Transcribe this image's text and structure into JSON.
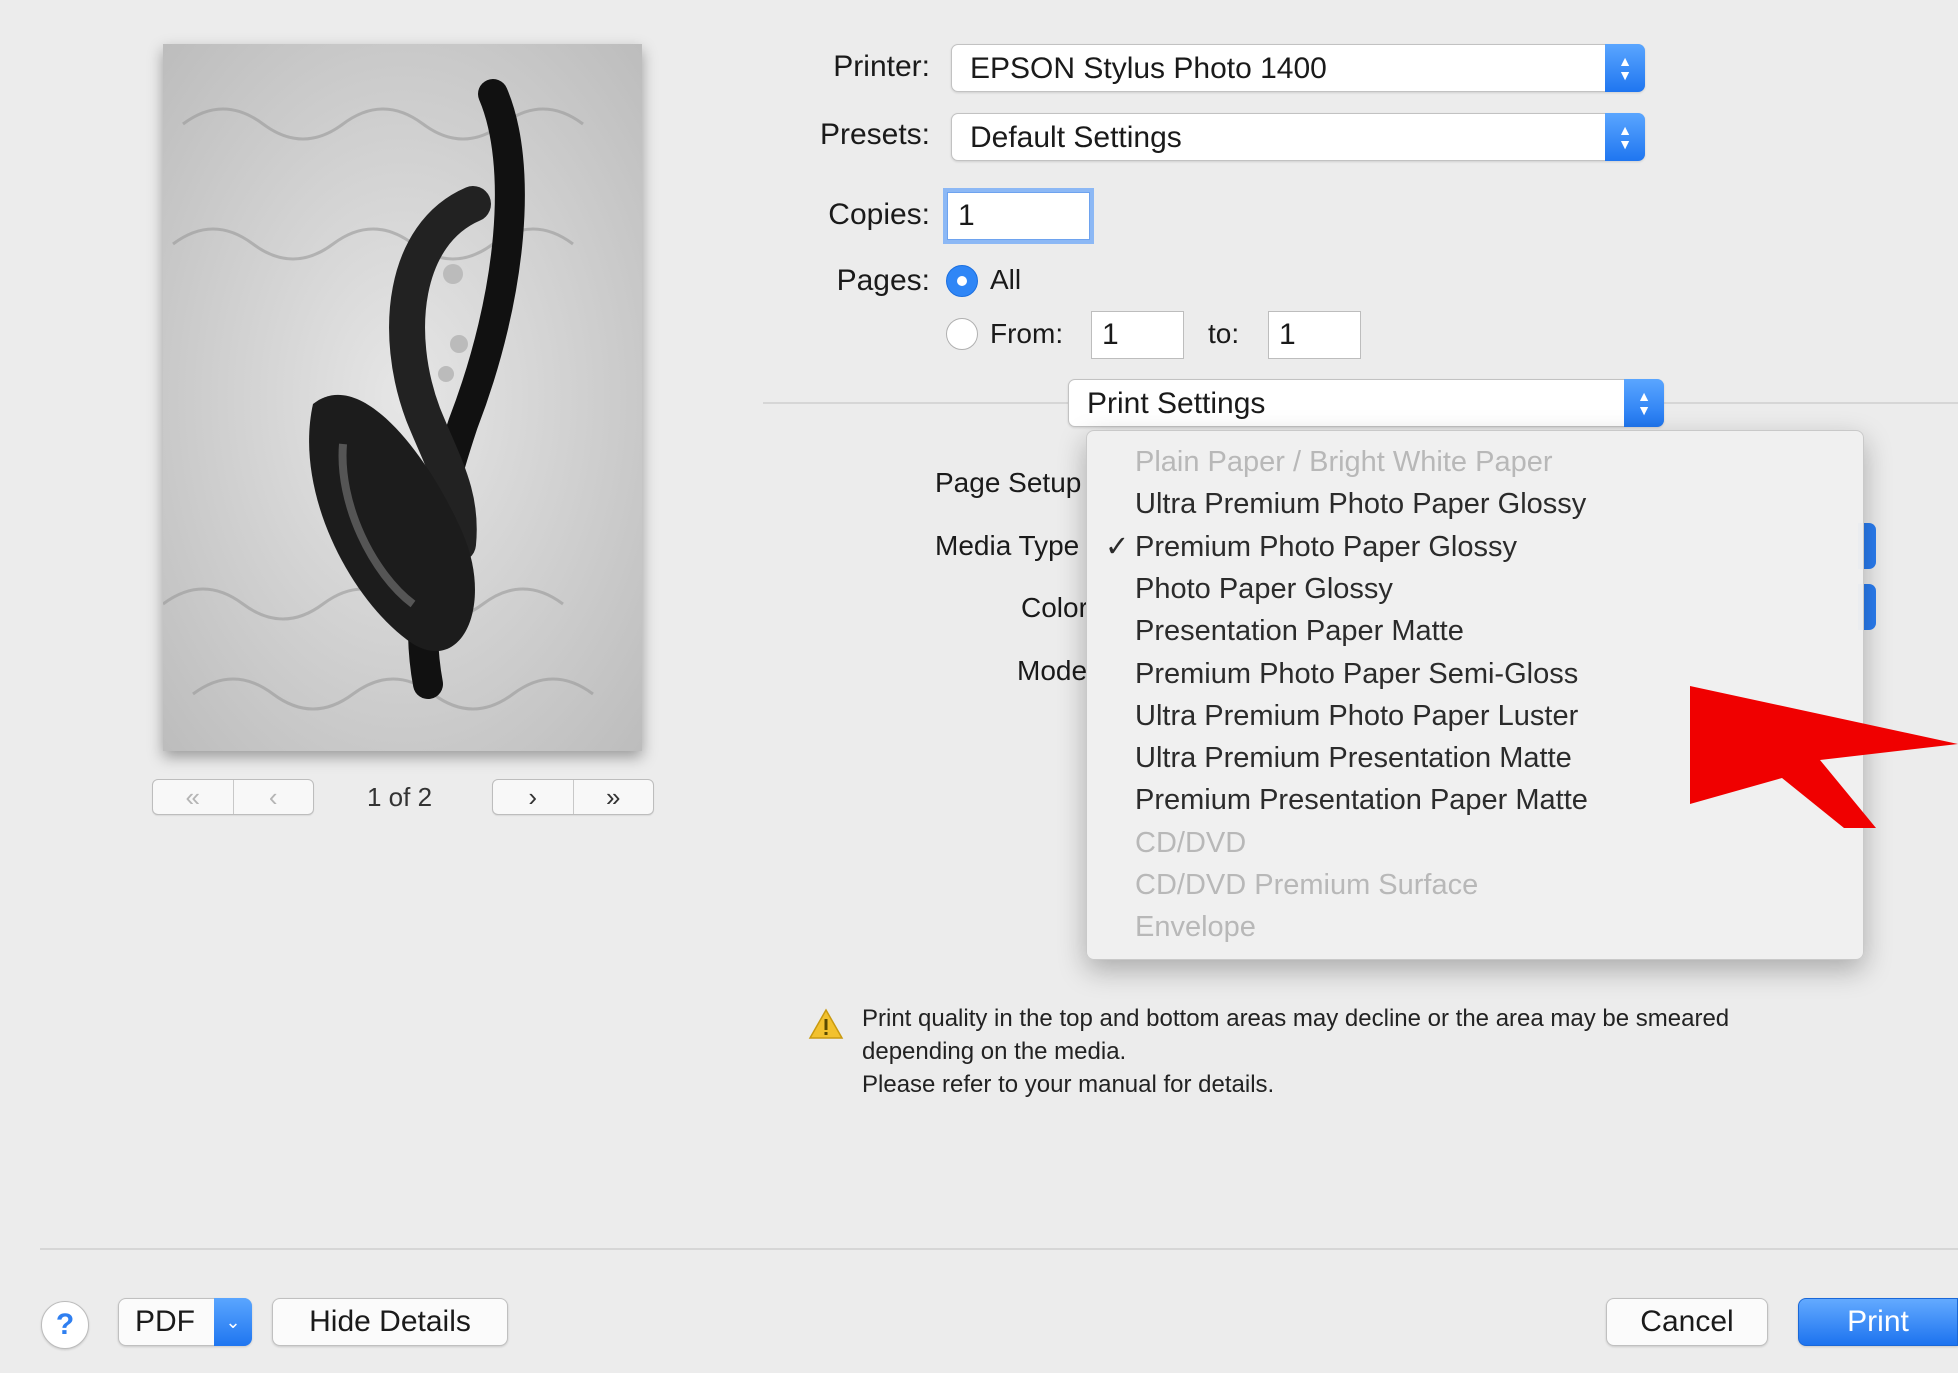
{
  "preview": {
    "page_indicator": "1 of 2",
    "nav_first": "«",
    "nav_prev": "‹",
    "nav_next": "›",
    "nav_last": "»"
  },
  "printer": {
    "label": "Printer:",
    "value": "EPSON Stylus Photo 1400"
  },
  "presets": {
    "label": "Presets:",
    "value": "Default Settings"
  },
  "copies": {
    "label": "Copies:",
    "value": "1"
  },
  "pages": {
    "label": "Pages:",
    "all_label": "All",
    "all_selected": true,
    "from_label": "From:",
    "from_value": "1",
    "to_label": "to:",
    "to_value": "1"
  },
  "section_popup": {
    "value": "Print Settings"
  },
  "settings_labels": {
    "page_setup": "Page Setup",
    "media_type": "Media Type",
    "color": "Color",
    "mode": "Mode"
  },
  "media_menu": {
    "items": [
      {
        "label": "Plain Paper / Bright White Paper",
        "enabled": false,
        "checked": false
      },
      {
        "label": "Ultra Premium Photo Paper Glossy",
        "enabled": true,
        "checked": false
      },
      {
        "label": "Premium Photo Paper Glossy",
        "enabled": true,
        "checked": true
      },
      {
        "label": "Photo Paper Glossy",
        "enabled": true,
        "checked": false
      },
      {
        "label": "Presentation Paper Matte",
        "enabled": true,
        "checked": false
      },
      {
        "label": "Premium Photo Paper Semi-Gloss",
        "enabled": true,
        "checked": false
      },
      {
        "label": "Ultra Premium Photo Paper Luster",
        "enabled": true,
        "checked": false
      },
      {
        "label": "Ultra Premium Presentation Matte",
        "enabled": true,
        "checked": false
      },
      {
        "label": "Premium Presentation Paper Matte",
        "enabled": true,
        "checked": false
      },
      {
        "label": "CD/DVD",
        "enabled": false,
        "checked": false
      },
      {
        "label": "CD/DVD Premium Surface",
        "enabled": false,
        "checked": false
      },
      {
        "label": "Envelope",
        "enabled": false,
        "checked": false
      }
    ],
    "check_glyph": "✓"
  },
  "warning": {
    "line1": "Print quality in the top and bottom areas may decline or the area may be smeared",
    "line2": "depending on the media.",
    "line3": "Please refer to your manual for details."
  },
  "footer": {
    "help": "?",
    "pdf": "PDF",
    "hide_details": "Hide Details",
    "cancel": "Cancel",
    "print": "Print"
  },
  "colors": {
    "accent": "#2f86f6",
    "annotation_arrow": "#f00000"
  }
}
